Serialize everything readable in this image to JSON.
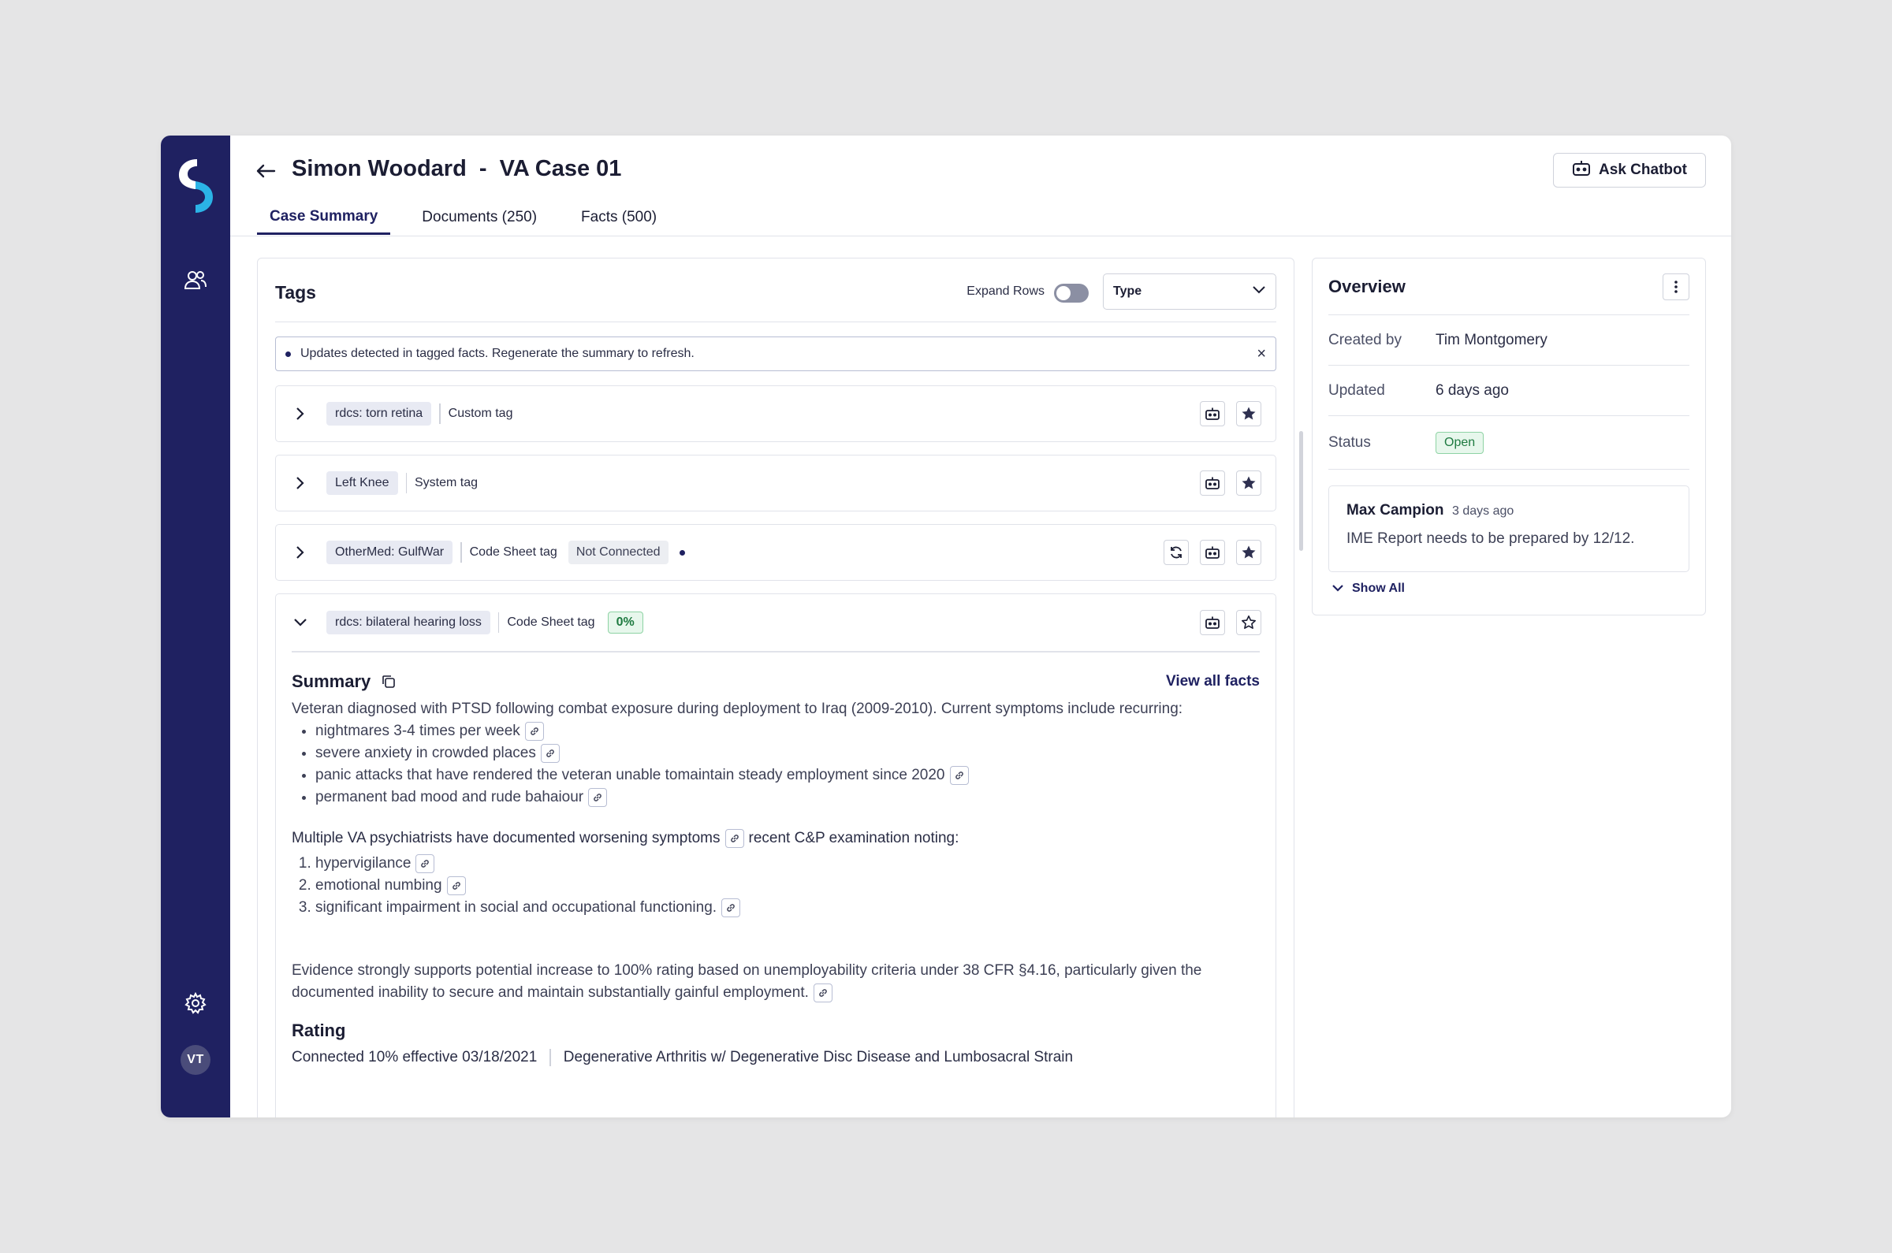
{
  "header": {
    "title": "Simon Woodard  -  VA Case 01",
    "chatbot_label": "Ask Chatbot",
    "tabs": [
      {
        "label": "Case Summary",
        "active": true
      },
      {
        "label": "Documents (250)",
        "active": false
      },
      {
        "label": "Facts (500)",
        "active": false
      }
    ]
  },
  "sidebar": {
    "avatar_initials": "VT"
  },
  "tags": {
    "title": "Tags",
    "expand_rows_label": "Expand Rows",
    "type_select_value": "Type",
    "alert_text": "Updates detected in tagged facts. Regenerate the summary to refresh.",
    "alert_close": "×",
    "rows": [
      {
        "chip": "rdcs: torn retina",
        "kind": "Custom tag"
      },
      {
        "chip": "Left Knee",
        "kind": "System tag"
      },
      {
        "chip": "OtherMed: GulfWar",
        "kind": "Code Sheet tag",
        "status": "Not Connected"
      },
      {
        "chip": "rdcs: bilateral hearing loss",
        "kind": "Code Sheet tag",
        "percent": "0%"
      }
    ]
  },
  "summary": {
    "title": "Summary",
    "view_all": "View all facts",
    "intro": "Veteran diagnosed with PTSD following combat exposure during deployment to Iraq (2009-2010). Current symptoms include recurring:",
    "bullets": [
      "nightmares 3-4 times per week",
      "severe anxiety in crowded places",
      "panic attacks that have rendered the veteran unable tomaintain steady employment since 2020",
      "permanent bad mood and rude bahaiour"
    ],
    "psych_line_a": "Multiple VA psychiatrists have documented worsening symptoms",
    "psych_line_b": "recent C&P examination noting:",
    "numbered": [
      "hypervigilance",
      "emotional numbing",
      "significant impairment in social and occupational functioning."
    ],
    "evidence": "Evidence strongly supports potential increase to 100% rating based on unemployability criteria under 38 CFR §4.16, particularly given the documented inability to secure and maintain substantially gainful employment.",
    "rating_title": "Rating",
    "rating_status": "Connected 10% effective 03/18/2021",
    "rating_desc": "Degenerative Arthritis w/ Degenerative Disc Disease and Lumbosacral Strain"
  },
  "overview": {
    "title": "Overview",
    "created_by_label": "Created by",
    "created_by": "Tim Montgomery",
    "updated_label": "Updated",
    "updated": "6 days ago",
    "status_label": "Status",
    "status": "Open",
    "note": {
      "author": "Max Campion",
      "time": "3 days ago",
      "text": "IME Report needs to be prepared by 12/12."
    },
    "show_all": "Show All"
  },
  "colors": {
    "sidebar": "#1f2161",
    "accent": "#1f2161",
    "success": "#1e7a40",
    "success_bg": "#e7f7ec",
    "logo_cyan": "#2bb3e6"
  }
}
